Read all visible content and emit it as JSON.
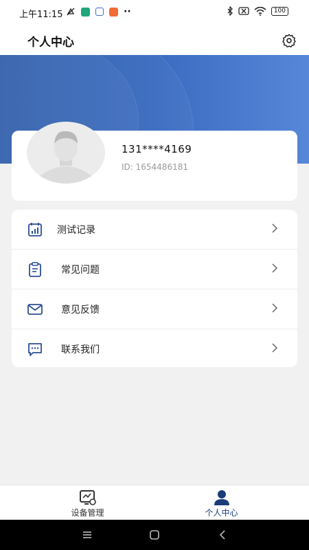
{
  "status_bar": {
    "time": "上午11:15",
    "dots": "··",
    "battery": "100"
  },
  "header": {
    "title": "个人中心",
    "settings_icon": "gear-icon"
  },
  "profile": {
    "phone": "131****4169",
    "user_id": "ID: 1654486181"
  },
  "menu": {
    "items": [
      {
        "label": "测试记录",
        "icon": "calendar-chart-icon"
      },
      {
        "label": "常见问题",
        "icon": "clipboard-icon"
      },
      {
        "label": "意见反馈",
        "icon": "mail-icon"
      },
      {
        "label": "联系我们",
        "icon": "chat-icon"
      }
    ]
  },
  "tabbar": {
    "tabs": [
      {
        "label": "设备管理",
        "icon": "device-icon",
        "active": false
      },
      {
        "label": "个人中心",
        "icon": "person-icon",
        "active": true
      }
    ]
  },
  "colors": {
    "accent": "#2f5daa",
    "active_tab": "#1a3d7a"
  }
}
